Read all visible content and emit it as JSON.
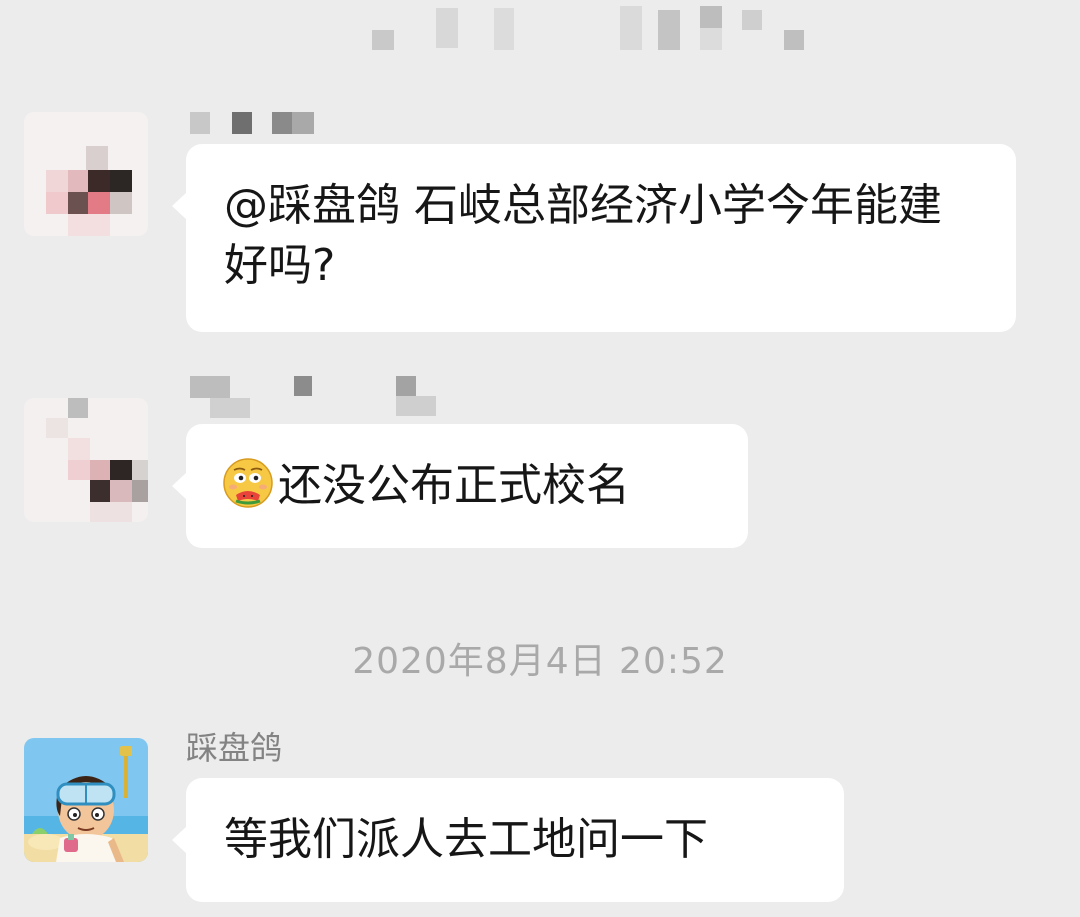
{
  "header": {
    "title_state": "pixelated"
  },
  "messages": [
    {
      "sender": "",
      "sender_state": "pixelated",
      "avatar_state": "pixelated",
      "mention": "@踩盘鸽",
      "text": "@踩盘鸽 石岐总部经济小学今年能建好吗?"
    },
    {
      "sender": "",
      "sender_state": "pixelated",
      "avatar_state": "pixelated",
      "emoji": "eating-watermelon-emoji",
      "text": "还没公布正式校名"
    },
    {
      "sender": "踩盘鸽",
      "avatar_state": "cartoon-snorkel-man",
      "text": "等我们派人去工地问一下"
    }
  ],
  "timestamp": "2020年8月4日 20:52",
  "colors": {
    "background": "#ececec",
    "bubble": "#ffffff",
    "text": "#161616",
    "meta_text": "#a9a9a9",
    "sender_text": "#838383"
  }
}
